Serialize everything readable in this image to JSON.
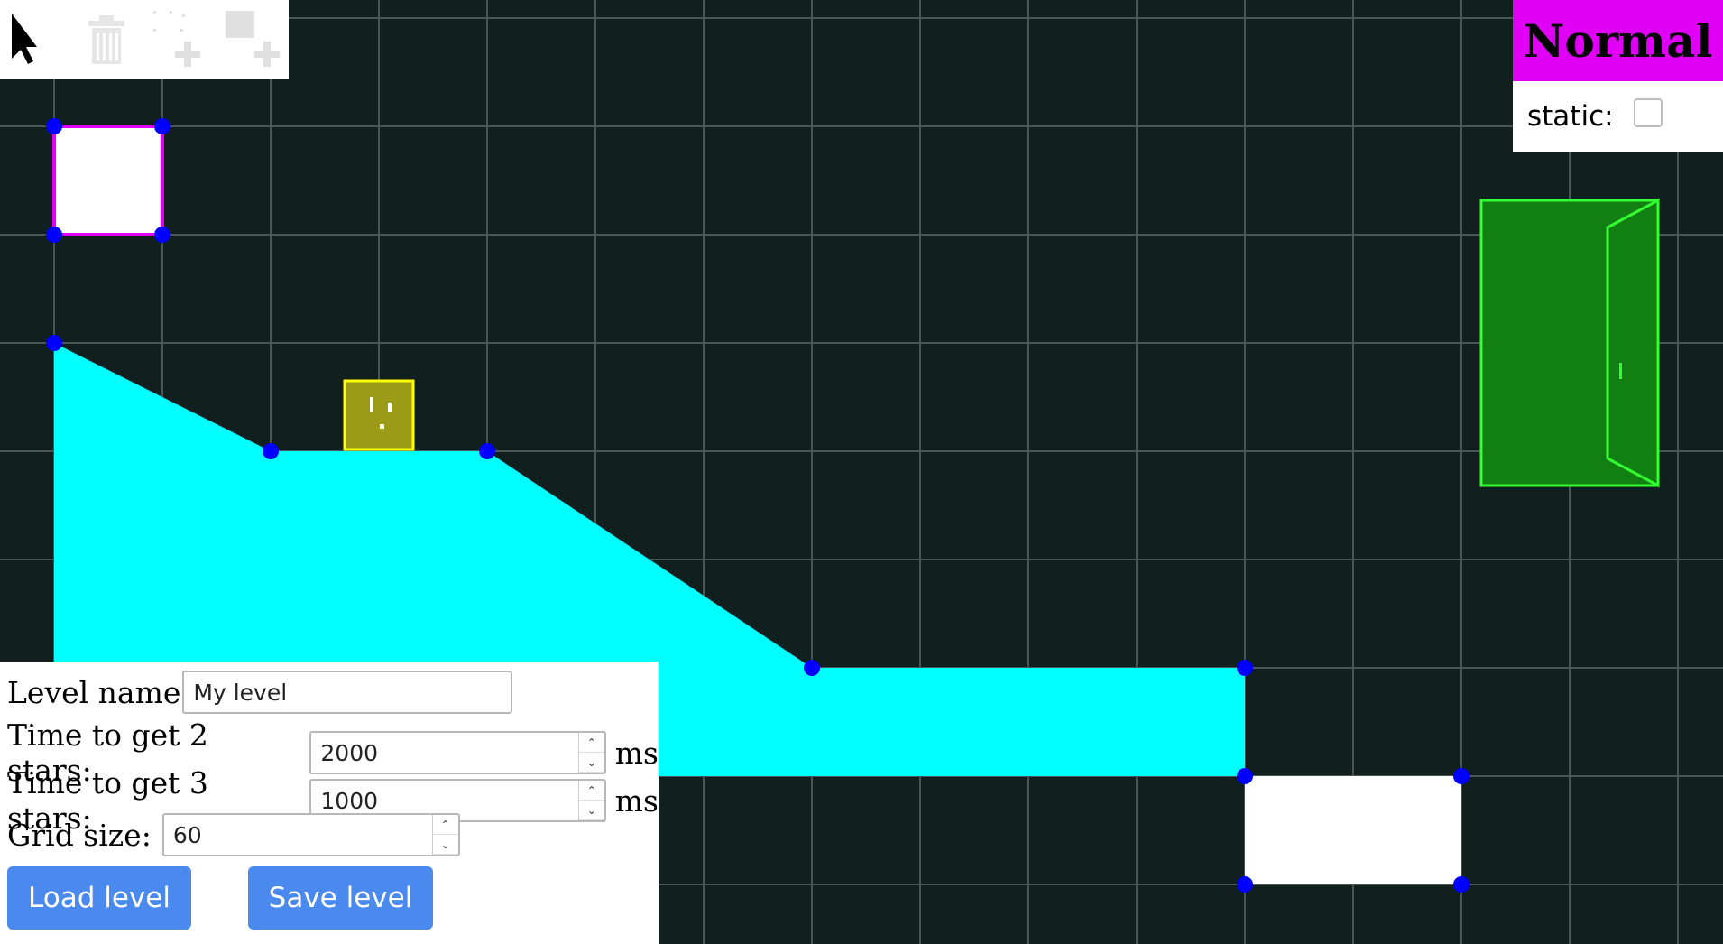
{
  "toolbar": {
    "tools": [
      {
        "name": "select-cursor-icon"
      },
      {
        "name": "trash-icon"
      },
      {
        "name": "add-polygon-icon"
      },
      {
        "name": "add-rectangle-icon"
      }
    ]
  },
  "mode_panel": {
    "mode": "Normal",
    "static_label": "static:",
    "static_checked": false
  },
  "settings": {
    "level_name_label": "Level name",
    "level_name_value": "My level",
    "two_stars_label": "Time to get 2 stars:",
    "two_stars_value": "2000",
    "two_stars_unit": "ms",
    "three_stars_label": "Time to get 3 stars:",
    "three_stars_value": "1000",
    "three_stars_unit": "ms",
    "grid_label": "Grid size:",
    "grid_value": "60",
    "load_button": "Load level",
    "save_button": "Save level"
  },
  "colors": {
    "background": "#121f1f",
    "grid": "#4a5555",
    "terrain": "#00ffff",
    "handle": "#0000ff",
    "selected_outline": "#e000f5",
    "player": "#9b9b18",
    "player_outline": "#ffff00",
    "door_fill": "#127f12",
    "door_outline": "#33ff33",
    "mode_bg": "#e000f5",
    "button": "#4a89ee"
  }
}
